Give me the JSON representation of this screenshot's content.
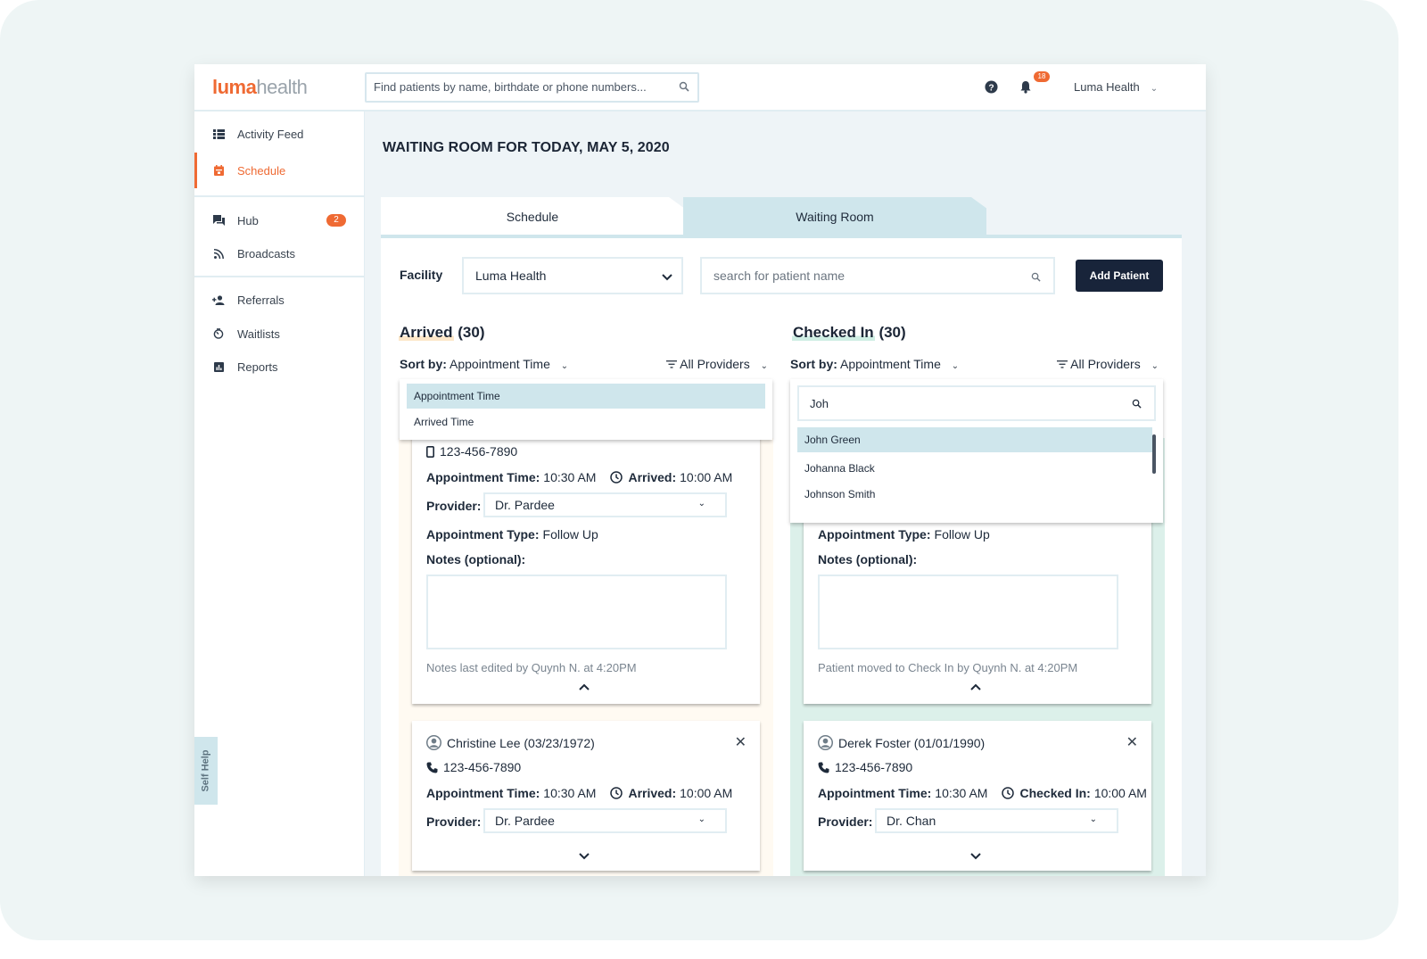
{
  "app": {
    "logo_primary": "luma",
    "logo_secondary": "health",
    "global_search_placeholder": "Find patients by name, birthdate or phone numbers...",
    "notification_count": "18",
    "user_name": "Luma Health",
    "accent_color": "#ef6a33",
    "dark_color": "#18243a"
  },
  "sidebar": {
    "items": [
      {
        "label": "Activity Feed",
        "icon": "list-icon",
        "active": false
      },
      {
        "label": "Schedule",
        "icon": "calendar-icon",
        "active": true
      },
      {
        "label": "Hub",
        "icon": "chat-icon",
        "badge": "2"
      },
      {
        "label": "Broadcasts",
        "icon": "rss-icon"
      },
      {
        "label": "Referrals",
        "icon": "add-person-icon"
      },
      {
        "label": "Waitlists",
        "icon": "timer-icon"
      },
      {
        "label": "Reports",
        "icon": "bar-chart-icon"
      }
    ],
    "self_help_label": "Self Help"
  },
  "main": {
    "page_title": "WAITING ROOM FOR TODAY, MAY 5, 2020",
    "tabs": [
      {
        "label": "Schedule",
        "active": false
      },
      {
        "label": "Waiting Room",
        "active": true
      }
    ],
    "facility_label": "Facility",
    "facility_value": "Luma Health",
    "patient_search_placeholder": "search for patient name",
    "add_patient_label": "Add Patient"
  },
  "columns": {
    "arrived": {
      "title": "Arrived",
      "count": "(30)",
      "sort_label": "Sort by:",
      "sort_value": "Appointment Time",
      "providers_label": "All Providers",
      "sort_options": [
        "Appointment Time",
        "Arrived Time"
      ],
      "sort_selected": "Appointment Time",
      "cards": [
        {
          "phone": "123-456-7890",
          "appt_label": "Appointment Time:",
          "appt_time": "10:30 AM",
          "status_label": "Arrived:",
          "status_time": "10:00 AM",
          "provider_label": "Provider:",
          "provider": "Dr. Pardee",
          "type_label": "Appointment Type:",
          "type": "Follow Up",
          "notes_label": "Notes (optional):",
          "notes_value": "",
          "meta": "Notes last edited by Quynh N. at 4:20PM",
          "expanded": true
        },
        {
          "name": "Christine Lee (03/23/1972)",
          "phone": "123-456-7890",
          "appt_label": "Appointment Time:",
          "appt_time": "10:30 AM",
          "status_label": "Arrived:",
          "status_time": "10:00 AM",
          "provider_label": "Provider:",
          "provider": "Dr. Pardee",
          "expanded": false
        }
      ]
    },
    "checked_in": {
      "title": "Checked In",
      "count": "(30)",
      "sort_label": "Sort by:",
      "sort_value": "Appointment Time",
      "providers_label": "All Providers",
      "search_value": "Joh",
      "search_results": [
        "John Green",
        "Johanna Black",
        "Johnson Smith"
      ],
      "search_selected": "John Green",
      "cards": [
        {
          "type_label": "Appointment Type:",
          "type": "Follow Up",
          "notes_label": "Notes (optional):",
          "notes_value": "",
          "meta": "Patient moved to Check In by Quynh N. at 4:20PM",
          "expanded": true
        },
        {
          "name": "Derek Foster (01/01/1990)",
          "phone": "123-456-7890",
          "appt_label": "Appointment Time:",
          "appt_time": "10:30 AM",
          "status_label": "Checked In:",
          "status_time": "10:00 AM",
          "provider_label": "Provider:",
          "provider": "Dr. Chan",
          "expanded": false
        }
      ]
    }
  }
}
